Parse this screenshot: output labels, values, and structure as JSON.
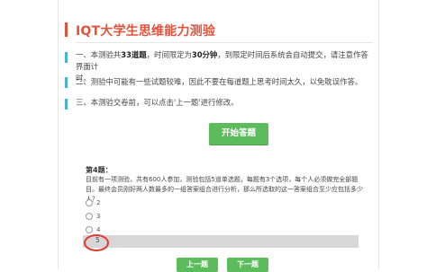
{
  "header": {
    "title": "IQT大学生思维能力测验"
  },
  "intro": {
    "line1_pre": "一、本测验共",
    "line1_count": "33道题",
    "line1_mid": "，时间限定为",
    "line1_time": "30分钟",
    "line1_post": "，到限定时间后系统会自动提交，请注意作答界面计",
    "line1_wrap": "时。",
    "line2": "二、测验中可能有一些试题较难，因此不要在每道题上思考时间太久，以免耽误作答。",
    "line3": "三、本测验交卷前，可以点击'上一题'进行修改。"
  },
  "start_button": "开始答题",
  "question": {
    "number": "第4题：",
    "text": "目前有一项测验，共有600人参加，测验包括5道单选题，每题有3个选项，每个人必须做完全部题目。最终会员刚好两人数最多的一组答案组合进行分析，那么所选取的这一答案组合至少应包括多少人？",
    "options": [
      "2",
      "3",
      "4",
      "5"
    ]
  },
  "nav": {
    "prev": "上一题",
    "next": "下一题"
  },
  "colors": {
    "accent": "#e2533c",
    "button": "#5cbb5a",
    "selected_bg": "#d7d7d7"
  }
}
